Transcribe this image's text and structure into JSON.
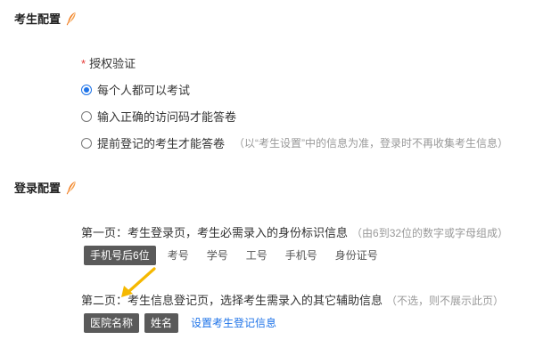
{
  "exam_config": {
    "title": "考生配置",
    "auth_label": "授权验证",
    "options": [
      {
        "label": "每个人都可以考试",
        "checked": true,
        "hint": ""
      },
      {
        "label": "输入正确的访问码才能答卷",
        "checked": false,
        "hint": ""
      },
      {
        "label": "提前登记的考生才能答卷",
        "checked": false,
        "hint": "（以“考生设置”中的信息为准，登录时不再收集考生信息）"
      }
    ]
  },
  "login_config": {
    "title": "登录配置",
    "page1": {
      "text": "第一页：考生登录页，考生必需录入的身份标识信息",
      "hint": "（由6到32位的数字或字母组成）",
      "tags": [
        {
          "label": "手机号后6位",
          "active": true
        },
        {
          "label": "考号",
          "active": false
        },
        {
          "label": "学号",
          "active": false
        },
        {
          "label": "工号",
          "active": false
        },
        {
          "label": "手机号",
          "active": false
        },
        {
          "label": "身份证号",
          "active": false
        }
      ]
    },
    "page2": {
      "text": "第二页：考生信息登记页，选择考生需录入的其它辅助信息",
      "hint": "（不选，则不展示此页）",
      "tags": [
        {
          "label": "医院名称",
          "active": true
        },
        {
          "label": "姓名",
          "active": true
        }
      ],
      "link": "设置考生登记信息"
    }
  },
  "icons": {
    "feather": "feather-icon",
    "arrow": "arrow-annotation-icon"
  },
  "colors": {
    "accent": "#1e73e8",
    "feather": "#f07c1e",
    "required": "#e53935",
    "tag_active_bg": "#5a5a5a",
    "arrow": "#f5b800"
  }
}
